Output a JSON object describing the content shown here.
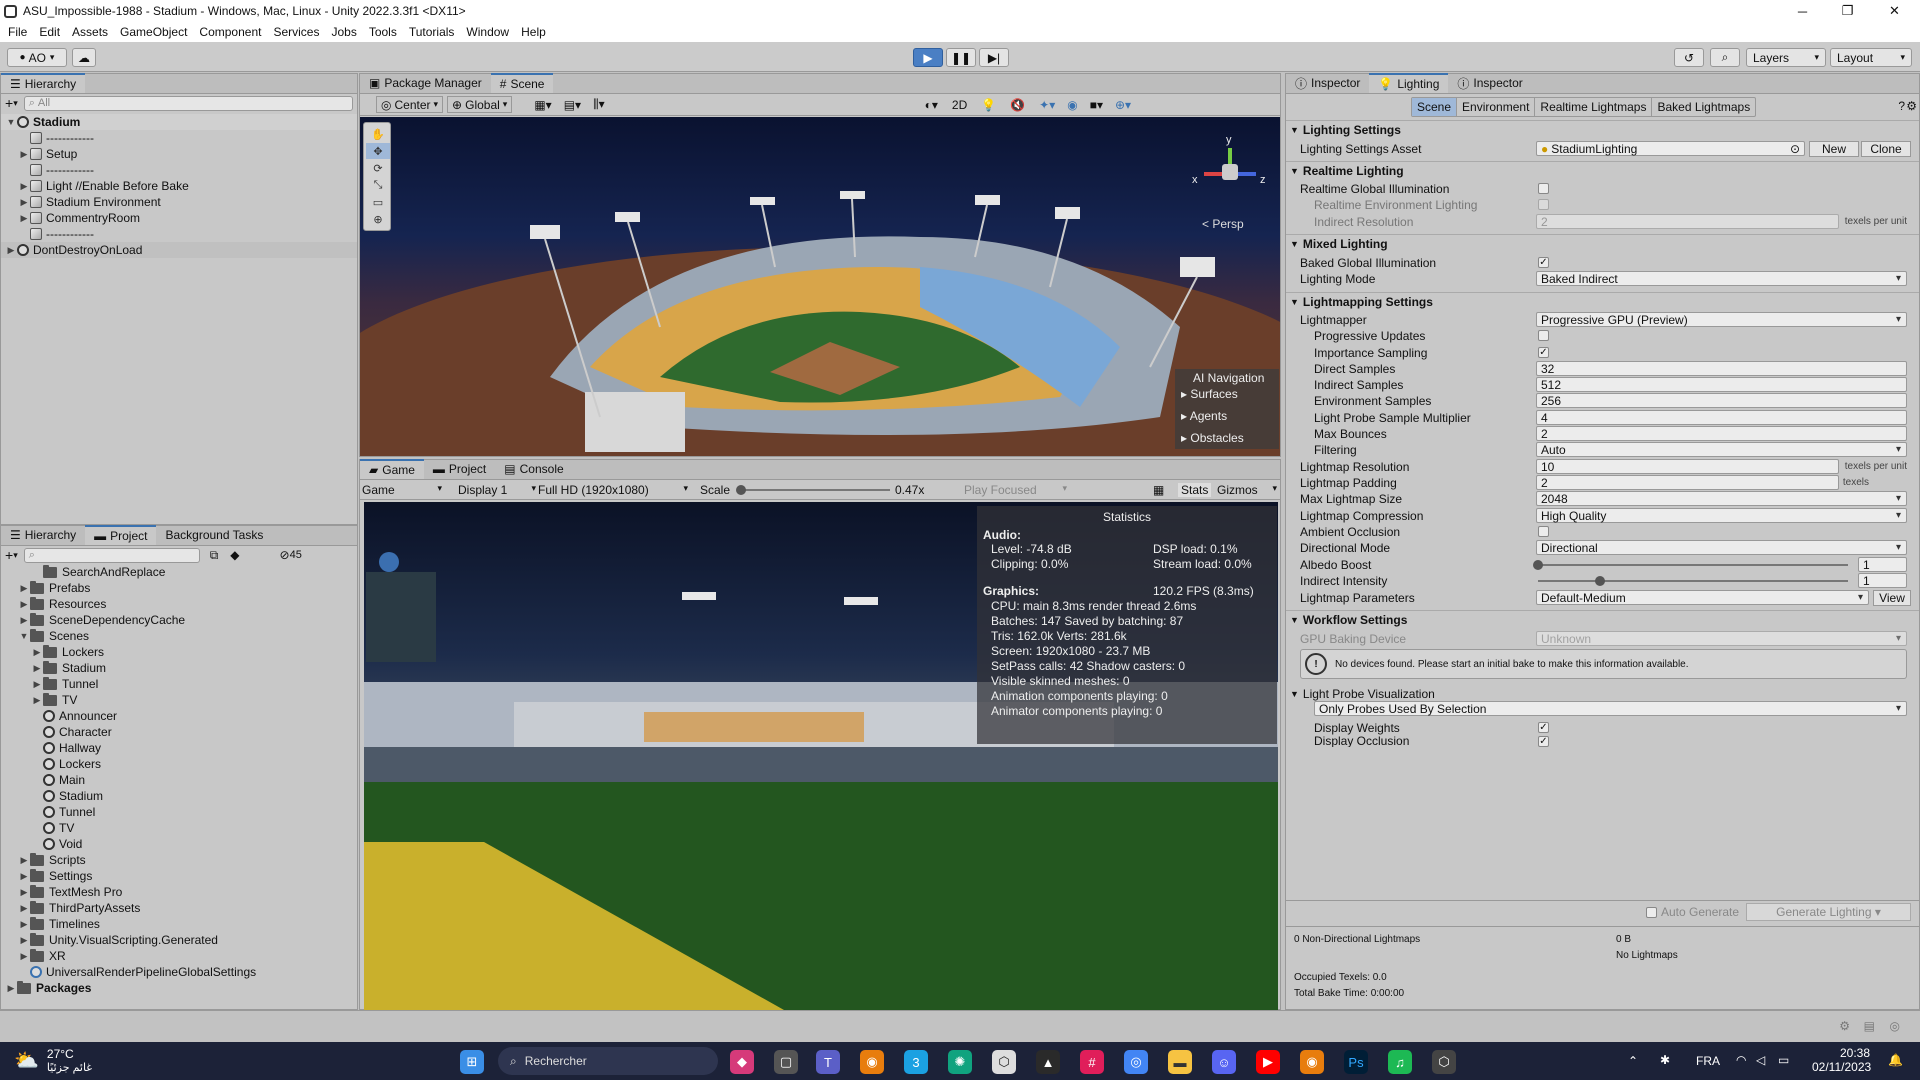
{
  "window": {
    "title": "ASU_Impossible-1988 - Stadium - Windows, Mac, Linux - Unity 2022.3.3f1 <DX11>",
    "controls": [
      "─",
      "❐",
      "✕"
    ]
  },
  "menu": [
    "File",
    "Edit",
    "Assets",
    "GameObject",
    "Component",
    "Services",
    "Jobs",
    "Tools",
    "Tutorials",
    "Window",
    "Help"
  ],
  "toolbar": {
    "account": "AO",
    "layers": "Layers",
    "layout": "Layout"
  },
  "hierarchy": {
    "tab": "Hierarchy",
    "search_placeholder": "All",
    "items": [
      {
        "label": "Stadium",
        "indent": 0,
        "type": "scene",
        "bold": true
      },
      {
        "label": "------------",
        "indent": 1,
        "type": "obj"
      },
      {
        "label": "Setup",
        "indent": 1,
        "type": "obj",
        "arrow": true
      },
      {
        "label": "------------",
        "indent": 1,
        "type": "obj"
      },
      {
        "label": "Light //Enable Before Bake",
        "indent": 1,
        "type": "obj",
        "arrow": true
      },
      {
        "label": "Stadium Environment",
        "indent": 1,
        "type": "obj",
        "arrow": true
      },
      {
        "label": "CommentryRoom",
        "indent": 1,
        "type": "obj",
        "arrow": true
      },
      {
        "label": "------------",
        "indent": 1,
        "type": "obj"
      },
      {
        "label": "DontDestroyOnLoad",
        "indent": 0,
        "type": "scene"
      }
    ]
  },
  "scene_tabs": [
    "Package Manager",
    "Scene"
  ],
  "scene_toolbar": {
    "pivot": "Center",
    "space": "Global",
    "mode2d": "2D"
  },
  "scene_view": {
    "persp_label": "Persp",
    "gizmo_y": "y",
    "gizmo_x": "x",
    "gizmo_z": "z",
    "ai_nav": {
      "title": "AI Navigation",
      "items": [
        "Surfaces",
        "Agents",
        "Obstacles"
      ]
    }
  },
  "game_tabs": [
    "Game",
    "Project",
    "Console"
  ],
  "game_toolbar": {
    "game": "Game",
    "display": "Display 1",
    "resolution": "Full HD (1920x1080)",
    "scale_label": "Scale",
    "scale_value": "0.47x",
    "play_focused": "Play Focused",
    "stats": "Stats",
    "gizmos": "Gizmos"
  },
  "statistics": {
    "title": "Statistics",
    "audio_label": "Audio:",
    "level": "Level: -74.8 dB",
    "dsp": "DSP load: 0.1%",
    "clipping": "Clipping: 0.0%",
    "stream": "Stream load: 0.0%",
    "graphics_label": "Graphics:",
    "fps": "120.2 FPS (8.3ms)",
    "cpu": "CPU: main 8.3ms  render thread 2.6ms",
    "batches": "Batches: 147   Saved by batching: 87",
    "tris": "Tris: 162.0k      Verts: 281.6k",
    "screen": "Screen: 1920x1080 - 23.7 MB",
    "setpass": "SetPass calls: 42       Shadow casters: 0",
    "skinned": "Visible skinned meshes: 0",
    "anim": "Animation components playing: 0",
    "animator": "Animator components playing: 0"
  },
  "project": {
    "tabs": [
      "Hierarchy",
      "Project",
      "Background Tasks"
    ],
    "hidden_count": "45",
    "items": [
      {
        "label": "SearchAndReplace",
        "indent": 2,
        "type": "folder"
      },
      {
        "label": "Prefabs",
        "indent": 1,
        "type": "folder",
        "arrow": true
      },
      {
        "label": "Resources",
        "indent": 1,
        "type": "folder",
        "arrow": true
      },
      {
        "label": "SceneDependencyCache",
        "indent": 1,
        "type": "folder",
        "arrow": true
      },
      {
        "label": "Scenes",
        "indent": 1,
        "type": "folder",
        "open": true
      },
      {
        "label": "Lockers",
        "indent": 2,
        "type": "folder",
        "arrow": true
      },
      {
        "label": "Stadium",
        "indent": 2,
        "type": "folder",
        "arrow": true
      },
      {
        "label": "Tunnel",
        "indent": 2,
        "type": "folder",
        "arrow": true
      },
      {
        "label": "TV",
        "indent": 2,
        "type": "folder",
        "arrow": true
      },
      {
        "label": "Announcer",
        "indent": 2,
        "type": "scene"
      },
      {
        "label": "Character",
        "indent": 2,
        "type": "scene"
      },
      {
        "label": "Hallway",
        "indent": 2,
        "type": "scene"
      },
      {
        "label": "Lockers",
        "indent": 2,
        "type": "scene"
      },
      {
        "label": "Main",
        "indent": 2,
        "type": "scene"
      },
      {
        "label": "Stadium",
        "indent": 2,
        "type": "scene"
      },
      {
        "label": "Tunnel",
        "indent": 2,
        "type": "scene"
      },
      {
        "label": "TV",
        "indent": 2,
        "type": "scene"
      },
      {
        "label": "Void",
        "indent": 2,
        "type": "scene"
      },
      {
        "label": "Scripts",
        "indent": 1,
        "type": "folder",
        "arrow": true
      },
      {
        "label": "Settings",
        "indent": 1,
        "type": "folder",
        "arrow": true
      },
      {
        "label": "TextMesh Pro",
        "indent": 1,
        "type": "folder",
        "arrow": true
      },
      {
        "label": "ThirdPartyAssets",
        "indent": 1,
        "type": "folder",
        "arrow": true
      },
      {
        "label": "Timelines",
        "indent": 1,
        "type": "folder",
        "arrow": true
      },
      {
        "label": "Unity.VisualScripting.Generated",
        "indent": 1,
        "type": "folder",
        "arrow": true
      },
      {
        "label": "XR",
        "indent": 1,
        "type": "folder",
        "arrow": true
      },
      {
        "label": "UniversalRenderPipelineGlobalSettings",
        "indent": 1,
        "type": "asset"
      },
      {
        "label": "Packages",
        "indent": 0,
        "type": "folder",
        "arrow": true,
        "bold": true
      }
    ]
  },
  "inspector_tabs": [
    "Inspector",
    "Lighting",
    "Inspector"
  ],
  "lighting": {
    "subtabs": [
      "Scene",
      "Environment",
      "Realtime Lightmaps",
      "Baked Lightmaps"
    ],
    "lighting_settings": {
      "header": "Lighting Settings",
      "asset_label": "Lighting Settings Asset",
      "asset_value": "StadiumLighting",
      "new": "New",
      "clone": "Clone"
    },
    "realtime": {
      "header": "Realtime Lighting",
      "rgi": "Realtime Global Illumination",
      "rel": "Realtime Environment Lighting",
      "ir": "Indirect Resolution",
      "ir_value": "2",
      "ir_unit": "texels per unit"
    },
    "mixed": {
      "header": "Mixed Lighting",
      "bgi": "Baked Global Illumination",
      "mode_label": "Lighting Mode",
      "mode_value": "Baked Indirect"
    },
    "lightmapping": {
      "header": "Lightmapping Settings",
      "lightmapper": "Lightmapper",
      "lightmapper_value": "Progressive GPU (Preview)",
      "prog_updates": "Progressive Updates",
      "importance": "Importance Sampling",
      "direct": "Direct Samples",
      "direct_v": "32",
      "indirect": "Indirect Samples",
      "indirect_v": "512",
      "env": "Environment Samples",
      "env_v": "256",
      "probe_mult": "Light Probe Sample Multiplier",
      "probe_mult_v": "4",
      "bounces": "Max Bounces",
      "bounces_v": "2",
      "filtering": "Filtering",
      "filtering_v": "Auto",
      "resolution": "Lightmap Resolution",
      "resolution_v": "10",
      "resolution_u": "texels per unit",
      "padding": "Lightmap Padding",
      "padding_v": "2",
      "padding_u": "texels",
      "max_size": "Max Lightmap Size",
      "max_size_v": "2048",
      "compression": "Lightmap Compression",
      "compression_v": "High Quality",
      "ao": "Ambient Occlusion",
      "dir_mode": "Directional Mode",
      "dir_mode_v": "Directional",
      "albedo": "Albedo Boost",
      "albedo_v": "1",
      "albedo_fraction": 0.0,
      "ind_int": "Indirect Intensity",
      "ind_int_v": "1",
      "ind_int_fraction": 0.2,
      "params": "Lightmap Parameters",
      "params_v": "Default-Medium",
      "view": "View"
    },
    "workflow": {
      "header": "Workflow Settings",
      "gpu_label": "GPU Baking Device",
      "gpu_value": "Unknown",
      "notice": "No devices found. Please start an initial bake to make this information available.",
      "probe_vis": "Light Probe Visualization",
      "probe_vis_v": "Only Probes Used By Selection",
      "weights": "Display Weights",
      "occlusion": "Display Occlusion"
    },
    "auto_generate": "Auto Generate",
    "generate": "Generate Lighting",
    "footer": {
      "nondir": "0 Non-Directional Lightmaps",
      "size": "0 B",
      "no_lm": "No Lightmaps",
      "occupied": "Occupied Texels: 0.0",
      "bake_time": "Total Bake Time: 0:00:00"
    }
  },
  "taskbar": {
    "weather_temp": "27°C",
    "weather_desc": "غائم جزئيًا",
    "search": "Rechercher",
    "lang": "FRA",
    "time": "20:38",
    "date": "02/11/2023"
  }
}
